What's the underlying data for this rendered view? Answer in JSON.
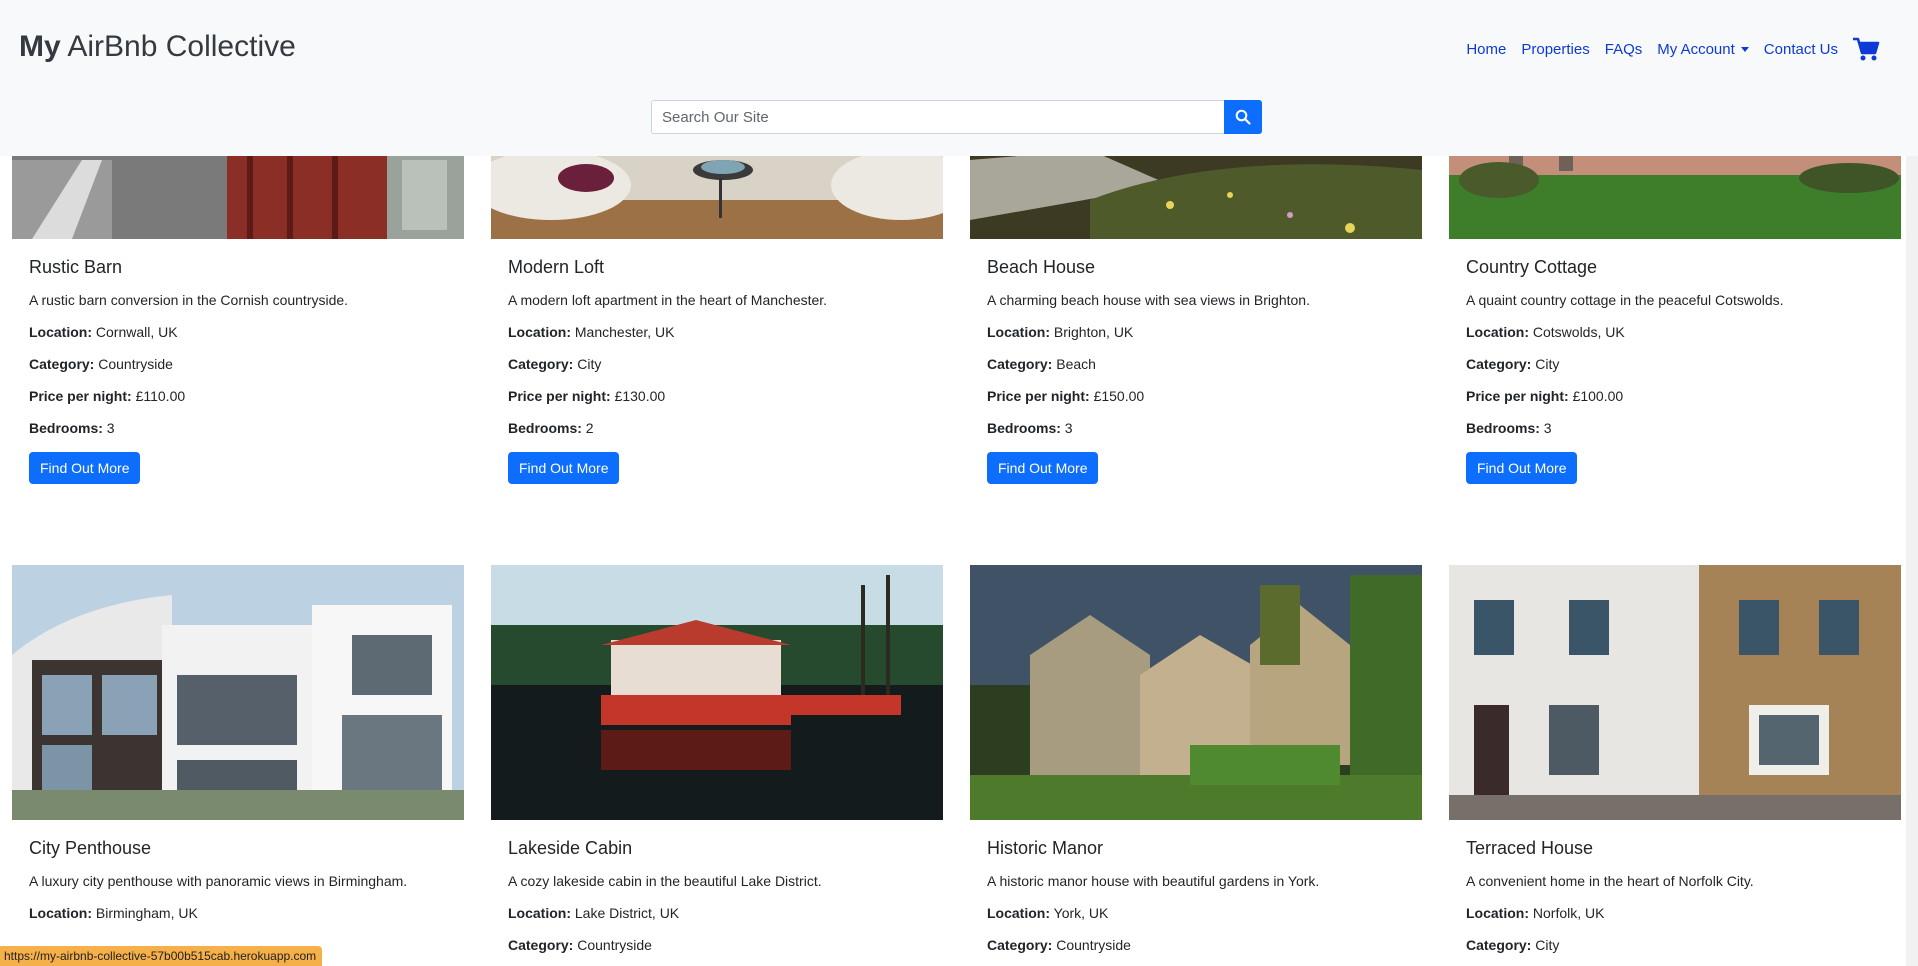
{
  "brand": {
    "bold": "My",
    "rest": " AirBnb Collective"
  },
  "nav": {
    "items": [
      {
        "label": "Home"
      },
      {
        "label": "Properties"
      },
      {
        "label": "FAQs"
      },
      {
        "label": "My Account"
      },
      {
        "label": "Contact Us"
      }
    ]
  },
  "search": {
    "placeholder": "Search Our Site"
  },
  "labels": {
    "location": "Location:",
    "category": "Category:",
    "price": "Price per night:",
    "bedrooms": "Bedrooms:",
    "button": "Find Out More"
  },
  "properties": [
    {
      "title": "Rustic Barn",
      "desc": "A rustic barn conversion in the Cornish countryside.",
      "location": "Cornwall, UK",
      "category": "Countryside",
      "price": "£110.00",
      "bedrooms": "3"
    },
    {
      "title": "Modern Loft",
      "desc": "A modern loft apartment in the heart of Manchester.",
      "location": "Manchester, UK",
      "category": "City",
      "price": "£130.00",
      "bedrooms": "2"
    },
    {
      "title": "Beach House",
      "desc": "A charming beach house with sea views in Brighton.",
      "location": "Brighton, UK",
      "category": "Beach",
      "price": "£150.00",
      "bedrooms": "3"
    },
    {
      "title": "Country Cottage",
      "desc": "A quaint country cottage in the peaceful Cotswolds.",
      "location": "Cotswolds, UK",
      "category": "City",
      "price": "£100.00",
      "bedrooms": "3"
    },
    {
      "title": "City Penthouse",
      "desc": "A luxury city penthouse with panoramic views in Birmingham.",
      "location": "Birmingham, UK"
    },
    {
      "title": "Lakeside Cabin",
      "desc": "A cozy lakeside cabin in the beautiful Lake District.",
      "location": "Lake District, UK",
      "category": "Countryside"
    },
    {
      "title": "Historic Manor",
      "desc": "A historic manor house with beautiful gardens in York.",
      "location": "York, UK",
      "category": "Countryside"
    },
    {
      "title": "Terraced House",
      "desc": "A convenient home in the heart of Norfolk City.",
      "location": "Norfolk, UK",
      "category": "City"
    }
  ],
  "status_url": "https://my-airbnb-collective-57b00b515cab.herokuapp.com",
  "colors": {
    "primary": "#0d6efd",
    "nav_link": "#0d3ad6",
    "header_bg": "#f8f9fa"
  }
}
